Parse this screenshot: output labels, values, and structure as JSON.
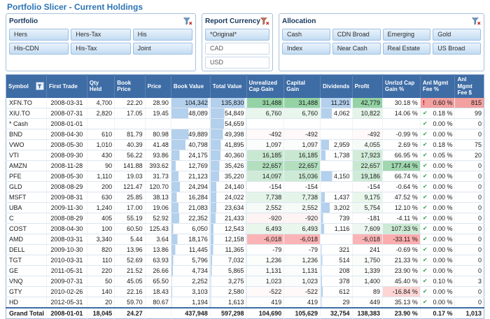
{
  "title": "Portfolio Slicer - Current Holdings",
  "colors": {
    "accent": "#2C74B5",
    "header_bg": "#3E6CA5",
    "bar_blue": "#B3D0EC",
    "positive_green": "#63BE7B",
    "negative_red": "#F8696B",
    "alert_pink": "#F2A0A0"
  },
  "slicers": {
    "portfolio": {
      "title": "Portfolio",
      "columns": 3,
      "items": [
        {
          "label": "Hers",
          "selected": true
        },
        {
          "label": "Hers-Tax",
          "selected": true
        },
        {
          "label": "His",
          "selected": true
        },
        {
          "label": "His-CDN",
          "selected": true
        },
        {
          "label": "His-Tax",
          "selected": true
        },
        {
          "label": "Joint",
          "selected": true
        }
      ]
    },
    "currency": {
      "title": "Report Currency",
      "columns": 1,
      "items": [
        {
          "label": "*Original*",
          "selected": true
        },
        {
          "label": "CAD",
          "selected": false
        },
        {
          "label": "USD",
          "selected": false
        }
      ]
    },
    "allocation": {
      "title": "Allocation",
      "columns": 4,
      "items": [
        {
          "label": "Cash",
          "selected": true
        },
        {
          "label": "CDN Broad",
          "selected": true
        },
        {
          "label": "Emerging",
          "selected": true
        },
        {
          "label": "Gold",
          "selected": true
        },
        {
          "label": "Index",
          "selected": true
        },
        {
          "label": "Near Cash",
          "selected": true
        },
        {
          "label": "Real Estate",
          "selected": true
        },
        {
          "label": "US Broad",
          "selected": true
        }
      ]
    }
  },
  "table": {
    "columns": [
      "Symbol",
      "First Trade",
      "Qty Held",
      "Book Price",
      "Price",
      "Book Value",
      "Total Value",
      "Unrealized Cap Gain",
      "Capital Gain",
      "Dividends",
      "Profit",
      "Unrlzd Cap Gain %",
      "Anl Mgmt Fee %",
      "Anl Mgmt Fee $"
    ],
    "rows": [
      {
        "symbol": "XFN.TO",
        "first_trade": "2008-03-31",
        "qty_held": "4,700",
        "book_price": "22.20",
        "price": "28.90",
        "book_value": "104,342",
        "total_value": "135,830",
        "unrealized_cap_gain": "31,488",
        "capital_gain": "31,488",
        "dividends": "11,291",
        "profit": "42,779",
        "unrlzd_cap_gain_pct": "30.18 %",
        "fee_icon": "red-alert",
        "anl_mgmt_fee_pct": "0.60 %",
        "anl_mgmt_fee_usd": "815",
        "fee_alert": true
      },
      {
        "symbol": "XIU.TO",
        "first_trade": "2008-07-31",
        "qty_held": "2,820",
        "book_price": "17.05",
        "price": "19.45",
        "book_value": "48,089",
        "total_value": "54,849",
        "unrealized_cap_gain": "6,760",
        "capital_gain": "6,760",
        "dividends": "4,062",
        "profit": "10,822",
        "unrlzd_cap_gain_pct": "14.06 %",
        "fee_icon": "green-check",
        "anl_mgmt_fee_pct": "0.18 %",
        "anl_mgmt_fee_usd": "99"
      },
      {
        "symbol": "* Cash",
        "first_trade": "2008-01-01",
        "qty_held": "",
        "book_price": "",
        "price": "",
        "book_value": "",
        "total_value": "54,659",
        "unrealized_cap_gain": "",
        "capital_gain": "",
        "dividends": "",
        "profit": "",
        "unrlzd_cap_gain_pct": "",
        "fee_icon": "green-check",
        "anl_mgmt_fee_pct": "0.00 %",
        "anl_mgmt_fee_usd": "0"
      },
      {
        "symbol": "BND",
        "first_trade": "2008-04-30",
        "qty_held": "610",
        "book_price": "81.79",
        "price": "80.98",
        "book_value": "49,889",
        "total_value": "49,398",
        "unrealized_cap_gain": "-492",
        "capital_gain": "-492",
        "dividends": "",
        "profit": "-492",
        "unrlzd_cap_gain_pct": "-0.99 %",
        "fee_icon": "green-check",
        "anl_mgmt_fee_pct": "0.00 %",
        "anl_mgmt_fee_usd": "0"
      },
      {
        "symbol": "VWO",
        "first_trade": "2008-05-30",
        "qty_held": "1,010",
        "book_price": "40.39",
        "price": "41.48",
        "book_value": "40,798",
        "total_value": "41,895",
        "unrealized_cap_gain": "1,097",
        "capital_gain": "1,097",
        "dividends": "2,959",
        "profit": "4,055",
        "unrlzd_cap_gain_pct": "2.69 %",
        "fee_icon": "green-check",
        "anl_mgmt_fee_pct": "0.18 %",
        "anl_mgmt_fee_usd": "75"
      },
      {
        "symbol": "VTI",
        "first_trade": "2008-09-30",
        "qty_held": "430",
        "book_price": "56.22",
        "price": "93.86",
        "book_value": "24,175",
        "total_value": "40,360",
        "unrealized_cap_gain": "16,185",
        "capital_gain": "16,185",
        "dividends": "1,738",
        "profit": "17,923",
        "unrlzd_cap_gain_pct": "66.95 %",
        "fee_icon": "green-check",
        "anl_mgmt_fee_pct": "0.05 %",
        "anl_mgmt_fee_usd": "20"
      },
      {
        "symbol": "AMZN",
        "first_trade": "2008-11-28",
        "qty_held": "90",
        "book_price": "141.88",
        "price": "393.62",
        "book_value": "12,769",
        "total_value": "35,426",
        "unrealized_cap_gain": "22,657",
        "capital_gain": "22,657",
        "dividends": "",
        "profit": "22,657",
        "unrlzd_cap_gain_pct": "177.44 %",
        "fee_icon": "green-check",
        "anl_mgmt_fee_pct": "0.00 %",
        "anl_mgmt_fee_usd": "0"
      },
      {
        "symbol": "PFE",
        "first_trade": "2008-05-30",
        "qty_held": "1,110",
        "book_price": "19.03",
        "price": "31.73",
        "book_value": "21,123",
        "total_value": "35,220",
        "unrealized_cap_gain": "14,097",
        "capital_gain": "15,036",
        "dividends": "4,150",
        "profit": "19,186",
        "unrlzd_cap_gain_pct": "66.74 %",
        "fee_icon": "green-check",
        "anl_mgmt_fee_pct": "0.00 %",
        "anl_mgmt_fee_usd": "0"
      },
      {
        "symbol": "GLD",
        "first_trade": "2008-08-29",
        "qty_held": "200",
        "book_price": "121.47",
        "price": "120.70",
        "book_value": "24,294",
        "total_value": "24,140",
        "unrealized_cap_gain": "-154",
        "capital_gain": "-154",
        "dividends": "",
        "profit": "-154",
        "unrlzd_cap_gain_pct": "-0.64 %",
        "fee_icon": "green-check",
        "anl_mgmt_fee_pct": "0.00 %",
        "anl_mgmt_fee_usd": "0"
      },
      {
        "symbol": "MSFT",
        "first_trade": "2009-08-31",
        "qty_held": "630",
        "book_price": "25.85",
        "price": "38.13",
        "book_value": "16,284",
        "total_value": "24,022",
        "unrealized_cap_gain": "7,738",
        "capital_gain": "7,738",
        "dividends": "1,437",
        "profit": "9,175",
        "unrlzd_cap_gain_pct": "47.52 %",
        "fee_icon": "green-check",
        "anl_mgmt_fee_pct": "0.00 %",
        "anl_mgmt_fee_usd": "0"
      },
      {
        "symbol": "UBA",
        "first_trade": "2009-11-30",
        "qty_held": "1,240",
        "book_price": "17.00",
        "price": "19.06",
        "book_value": "21,083",
        "total_value": "23,634",
        "unrealized_cap_gain": "2,552",
        "capital_gain": "2,552",
        "dividends": "3,202",
        "profit": "5,754",
        "unrlzd_cap_gain_pct": "12.10 %",
        "fee_icon": "green-check",
        "anl_mgmt_fee_pct": "0.00 %",
        "anl_mgmt_fee_usd": "0"
      },
      {
        "symbol": "C",
        "first_trade": "2008-08-29",
        "qty_held": "405",
        "book_price": "55.19",
        "price": "52.92",
        "book_value": "22,352",
        "total_value": "21,433",
        "unrealized_cap_gain": "-920",
        "capital_gain": "-920",
        "dividends": "739",
        "profit": "-181",
        "unrlzd_cap_gain_pct": "-4.11 %",
        "fee_icon": "green-check",
        "anl_mgmt_fee_pct": "0.00 %",
        "anl_mgmt_fee_usd": "0"
      },
      {
        "symbol": "COST",
        "first_trade": "2008-04-30",
        "qty_held": "100",
        "book_price": "60.50",
        "price": "125.43",
        "book_value": "6,050",
        "total_value": "12,543",
        "unrealized_cap_gain": "6,493",
        "capital_gain": "6,493",
        "dividends": "1,116",
        "profit": "7,609",
        "unrlzd_cap_gain_pct": "107.33 %",
        "fee_icon": "green-check",
        "anl_mgmt_fee_pct": "0.00 %",
        "anl_mgmt_fee_usd": "0"
      },
      {
        "symbol": "AMD",
        "first_trade": "2008-03-31",
        "qty_held": "3,340",
        "book_price": "5.44",
        "price": "3.64",
        "book_value": "18,176",
        "total_value": "12,158",
        "unrealized_cap_gain": "-6,018",
        "capital_gain": "-6,018",
        "dividends": "",
        "profit": "-6,018",
        "unrlzd_cap_gain_pct": "-33.11 %",
        "fee_icon": "green-check",
        "anl_mgmt_fee_pct": "0.00 %",
        "anl_mgmt_fee_usd": "0"
      },
      {
        "symbol": "DELL",
        "first_trade": "2009-10-30",
        "qty_held": "820",
        "book_price": "13.96",
        "price": "13.86",
        "book_value": "11,445",
        "total_value": "11,365",
        "unrealized_cap_gain": "-79",
        "capital_gain": "-79",
        "dividends": "321",
        "profit": "241",
        "unrlzd_cap_gain_pct": "-0.69 %",
        "fee_icon": "green-check",
        "anl_mgmt_fee_pct": "0.00 %",
        "anl_mgmt_fee_usd": "0"
      },
      {
        "symbol": "TGT",
        "first_trade": "2010-03-31",
        "qty_held": "110",
        "book_price": "52.69",
        "price": "63.93",
        "book_value": "5,796",
        "total_value": "7,032",
        "unrealized_cap_gain": "1,236",
        "capital_gain": "1,236",
        "dividends": "514",
        "profit": "1,750",
        "unrlzd_cap_gain_pct": "21.33 %",
        "fee_icon": "green-check",
        "anl_mgmt_fee_pct": "0.00 %",
        "anl_mgmt_fee_usd": "0"
      },
      {
        "symbol": "GE",
        "first_trade": "2011-05-31",
        "qty_held": "220",
        "book_price": "21.52",
        "price": "26.66",
        "book_value": "4,734",
        "total_value": "5,865",
        "unrealized_cap_gain": "1,131",
        "capital_gain": "1,131",
        "dividends": "208",
        "profit": "1,339",
        "unrlzd_cap_gain_pct": "23.90 %",
        "fee_icon": "green-check",
        "anl_mgmt_fee_pct": "0.00 %",
        "anl_mgmt_fee_usd": "0"
      },
      {
        "symbol": "VNQ",
        "first_trade": "2009-07-31",
        "qty_held": "50",
        "book_price": "45.05",
        "price": "65.50",
        "book_value": "2,252",
        "total_value": "3,275",
        "unrealized_cap_gain": "1,023",
        "capital_gain": "1,023",
        "dividends": "378",
        "profit": "1,400",
        "unrlzd_cap_gain_pct": "45.40 %",
        "fee_icon": "green-check",
        "anl_mgmt_fee_pct": "0.10 %",
        "anl_mgmt_fee_usd": "3"
      },
      {
        "symbol": "GTY",
        "first_trade": "2010-02-26",
        "qty_held": "140",
        "book_price": "22.16",
        "price": "18.43",
        "book_value": "3,103",
        "total_value": "2,580",
        "unrealized_cap_gain": "-522",
        "capital_gain": "-522",
        "dividends": "612",
        "profit": "89",
        "unrlzd_cap_gain_pct": "-16.84 %",
        "fee_icon": "green-check",
        "anl_mgmt_fee_pct": "0.00 %",
        "anl_mgmt_fee_usd": "0"
      },
      {
        "symbol": "HD",
        "first_trade": "2012-05-31",
        "qty_held": "20",
        "book_price": "59.70",
        "price": "80.67",
        "book_value": "1,194",
        "total_value": "1,613",
        "unrealized_cap_gain": "419",
        "capital_gain": "419",
        "dividends": "29",
        "profit": "449",
        "unrlzd_cap_gain_pct": "35.13 %",
        "fee_icon": "green-check",
        "anl_mgmt_fee_pct": "0.00 %",
        "anl_mgmt_fee_usd": "0"
      }
    ],
    "grand_total": {
      "symbol": "Grand Total",
      "first_trade": "2008-01-01",
      "qty_held": "18,045",
      "book_price": "24.27",
      "price": "",
      "book_value": "437,948",
      "total_value": "597,298",
      "unrealized_cap_gain": "104,690",
      "capital_gain": "105,629",
      "dividends": "32,754",
      "profit": "138,383",
      "unrlzd_cap_gain_pct": "23.90 %",
      "fee_icon": "none",
      "anl_mgmt_fee_pct": "0.17 %",
      "anl_mgmt_fee_usd": "1,013"
    }
  }
}
